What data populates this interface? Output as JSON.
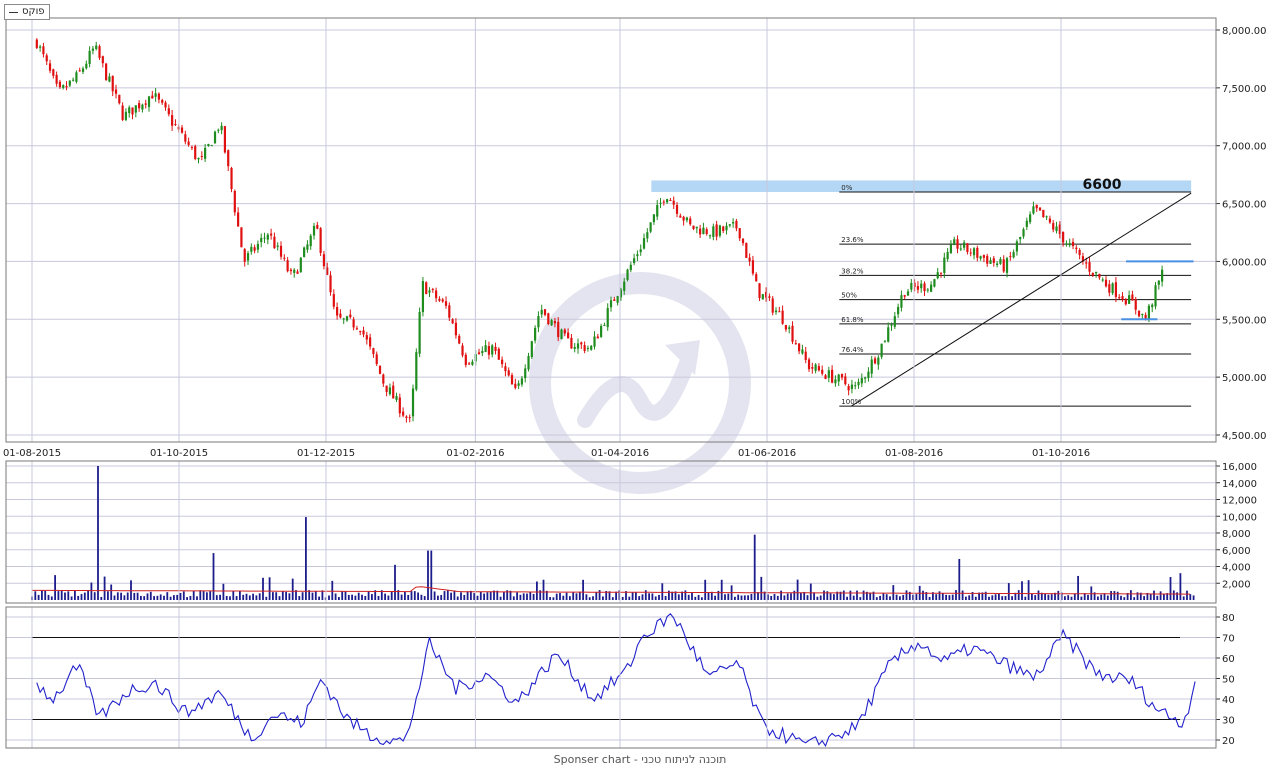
{
  "legend": {
    "label": "פוקס"
  },
  "footer": {
    "text": "Sponser chart - תוכנה לניתוח טכני"
  },
  "colors": {
    "up": "#1e8c1e",
    "down": "#e01010",
    "volume": "#1c1c8c",
    "volume_ma": "#d02020",
    "rsi": "#2222cc",
    "fib_zone": "#a8d0f4",
    "support": "#4a90e2",
    "grid": "#c8c8dc"
  },
  "chart_data": [
    {
      "type": "candlestick",
      "panel": "price",
      "title": "",
      "x_axis": {
        "tick_labels": [
          "01-08-2015",
          "01-10-2015",
          "01-12-2015",
          "01-02-2016",
          "01-04-2016",
          "01-06-2016",
          "01-08-2016",
          "01-10-2016"
        ]
      },
      "y_axis": {
        "range": [
          4500,
          8000
        ],
        "tick_values": [
          4500,
          5000,
          5500,
          6000,
          6500,
          7000,
          7500,
          8000
        ],
        "tick_labels": [
          "4,500.00",
          "5,000.00",
          "5,500.00",
          "6,000.00",
          "6,500.00",
          "7,000.00",
          "7,500.00",
          "8,000.00"
        ]
      },
      "close_path": [
        {
          "date": "2015-08-03",
          "close": 7900
        },
        {
          "date": "2015-08-12",
          "close": 7450
        },
        {
          "date": "2015-08-20",
          "close": 7600
        },
        {
          "date": "2015-08-27",
          "close": 7850
        },
        {
          "date": "2015-09-08",
          "close": 7250
        },
        {
          "date": "2015-09-20",
          "close": 7450
        },
        {
          "date": "2015-09-30",
          "close": 7150
        },
        {
          "date": "2015-10-10",
          "close": 6850
        },
        {
          "date": "2015-10-18",
          "close": 7200
        },
        {
          "date": "2015-10-28",
          "close": 6000
        },
        {
          "date": "2015-11-07",
          "close": 6250
        },
        {
          "date": "2015-11-17",
          "close": 5850
        },
        {
          "date": "2015-11-27",
          "close": 6300
        },
        {
          "date": "2015-12-05",
          "close": 5500
        },
        {
          "date": "2015-12-15",
          "close": 5450
        },
        {
          "date": "2015-12-25",
          "close": 4950
        },
        {
          "date": "2016-01-05",
          "close": 4600
        },
        {
          "date": "2016-01-10",
          "close": 5800
        },
        {
          "date": "2016-01-20",
          "close": 5600
        },
        {
          "date": "2016-01-28",
          "close": 5150
        },
        {
          "date": "2016-02-08",
          "close": 5250
        },
        {
          "date": "2016-02-18",
          "close": 4850
        },
        {
          "date": "2016-02-28",
          "close": 5600
        },
        {
          "date": "2016-03-10",
          "close": 5300
        },
        {
          "date": "2016-03-20",
          "close": 5250
        },
        {
          "date": "2016-03-30",
          "close": 5700
        },
        {
          "date": "2016-04-10",
          "close": 6150
        },
        {
          "date": "2016-04-20",
          "close": 6600
        },
        {
          "date": "2016-04-30",
          "close": 6300
        },
        {
          "date": "2016-05-10",
          "close": 6250
        },
        {
          "date": "2016-05-20",
          "close": 6300
        },
        {
          "date": "2016-05-28",
          "close": 5750
        },
        {
          "date": "2016-06-08",
          "close": 5500
        },
        {
          "date": "2016-06-18",
          "close": 5100
        },
        {
          "date": "2016-06-28",
          "close": 5000
        },
        {
          "date": "2016-07-08",
          "close": 4900
        },
        {
          "date": "2016-07-18",
          "close": 5250
        },
        {
          "date": "2016-07-28",
          "close": 5750
        },
        {
          "date": "2016-08-08",
          "close": 5800
        },
        {
          "date": "2016-08-18",
          "close": 6150
        },
        {
          "date": "2016-08-28",
          "close": 6050
        },
        {
          "date": "2016-09-08",
          "close": 5950
        },
        {
          "date": "2016-09-20",
          "close": 6450
        },
        {
          "date": "2016-09-30",
          "close": 6250
        },
        {
          "date": "2016-10-10",
          "close": 6000
        },
        {
          "date": "2016-10-20",
          "close": 5800
        },
        {
          "date": "2016-10-30",
          "close": 5650
        },
        {
          "date": "2016-11-05",
          "close": 5500
        },
        {
          "date": "2016-11-12",
          "close": 5900
        }
      ],
      "fibonacci": {
        "levels": [
          {
            "label": "0%",
            "value": 6600
          },
          {
            "label": "23.6%",
            "value": 6150
          },
          {
            "label": "38.2%",
            "value": 5880
          },
          {
            "label": "50%",
            "value": 5670
          },
          {
            "label": "61.8%",
            "value": 5460
          },
          {
            "label": "76.4%",
            "value": 5200
          },
          {
            "label": "100%",
            "value": 4750
          }
        ],
        "start_date": "2016-07-01",
        "end_date": "2016-11-24"
      },
      "resistance_zone": {
        "from": 6600,
        "to": 6700,
        "start_date": "2016-04-14",
        "end_date": "2016-11-24"
      },
      "annotation": {
        "text": "6600",
        "value": 6600,
        "date": "2016-10-18"
      },
      "trendline": [
        {
          "date": "2016-07-06",
          "value": 4750
        },
        {
          "date": "2016-11-24",
          "value": 6590
        }
      ],
      "support_lines": [
        {
          "value": 6000,
          "start_date": "2016-10-28",
          "end_date": "2016-11-25"
        },
        {
          "value": 5500,
          "start_date": "2016-10-26",
          "end_date": "2016-11-10"
        }
      ]
    },
    {
      "type": "bar",
      "panel": "volume",
      "y_axis": {
        "range": [
          0,
          16000
        ],
        "tick_values": [
          2000,
          4000,
          6000,
          8000,
          10000,
          12000,
          14000,
          16000
        ],
        "tick_labels": [
          "2,000",
          "4,000",
          "6,000",
          "8,000",
          "10,000",
          "12,000",
          "14,000",
          "16,000"
        ]
      },
      "spikes": [
        {
          "date": "2015-08-29",
          "value": 16000
        },
        {
          "date": "2015-08-31",
          "value": 2800
        },
        {
          "date": "2015-10-15",
          "value": 5600
        },
        {
          "date": "2015-11-23",
          "value": 9900
        },
        {
          "date": "2015-12-29",
          "value": 4200
        },
        {
          "date": "2016-01-13",
          "value": 5900
        },
        {
          "date": "2016-05-27",
          "value": 7800
        },
        {
          "date": "2016-08-20",
          "value": 4900
        },
        {
          "date": "2016-11-19",
          "value": 3200
        }
      ],
      "typical_level": 800,
      "moving_average_level": 1000
    },
    {
      "type": "line",
      "panel": "rsi",
      "y_axis": {
        "range": [
          15,
          85
        ],
        "tick_values": [
          20,
          30,
          40,
          50,
          60,
          70,
          80
        ],
        "tick_labels": [
          "20",
          "30",
          "40",
          "50",
          "60",
          "70",
          "80"
        ]
      },
      "reference_lines": [
        30,
        70
      ],
      "series": [
        {
          "values": [
            {
              "date": "2015-08-03",
              "value": 47
            },
            {
              "date": "2015-08-10",
              "value": 40
            },
            {
              "date": "2015-08-20",
              "value": 56
            },
            {
              "date": "2015-08-29",
              "value": 31
            },
            {
              "date": "2015-09-10",
              "value": 44
            },
            {
              "date": "2015-09-21",
              "value": 48
            },
            {
              "date": "2015-10-04",
              "value": 33
            },
            {
              "date": "2015-10-18",
              "value": 43
            },
            {
              "date": "2015-10-31",
              "value": 21
            },
            {
              "date": "2015-11-10",
              "value": 33
            },
            {
              "date": "2015-11-21",
              "value": 28
            },
            {
              "date": "2015-11-29",
              "value": 50
            },
            {
              "date": "2015-12-10",
              "value": 30
            },
            {
              "date": "2015-12-20",
              "value": 22
            },
            {
              "date": "2016-01-03",
              "value": 19
            },
            {
              "date": "2016-01-13",
              "value": 67
            },
            {
              "date": "2016-01-24",
              "value": 45
            },
            {
              "date": "2016-02-06",
              "value": 52
            },
            {
              "date": "2016-02-18",
              "value": 38
            },
            {
              "date": "2016-03-06",
              "value": 62
            },
            {
              "date": "2016-03-21",
              "value": 40
            },
            {
              "date": "2016-04-04",
              "value": 54
            },
            {
              "date": "2016-04-10",
              "value": 70
            },
            {
              "date": "2016-04-23",
              "value": 81
            },
            {
              "date": "2016-05-08",
              "value": 50
            },
            {
              "date": "2016-05-20",
              "value": 58
            },
            {
              "date": "2016-05-30",
              "value": 27
            },
            {
              "date": "2016-06-18",
              "value": 17
            },
            {
              "date": "2016-07-08",
              "value": 26
            },
            {
              "date": "2016-07-22",
              "value": 57
            },
            {
              "date": "2016-08-03",
              "value": 68
            },
            {
              "date": "2016-08-13",
              "value": 58
            },
            {
              "date": "2016-08-25",
              "value": 65
            },
            {
              "date": "2016-09-08",
              "value": 57
            },
            {
              "date": "2016-09-20",
              "value": 50
            },
            {
              "date": "2016-10-02",
              "value": 71
            },
            {
              "date": "2016-10-16",
              "value": 52
            },
            {
              "date": "2016-10-30",
              "value": 49
            },
            {
              "date": "2016-11-10",
              "value": 35
            },
            {
              "date": "2016-11-21",
              "value": 28
            },
            {
              "date": "2016-11-27",
              "value": 55
            }
          ]
        }
      ]
    }
  ]
}
